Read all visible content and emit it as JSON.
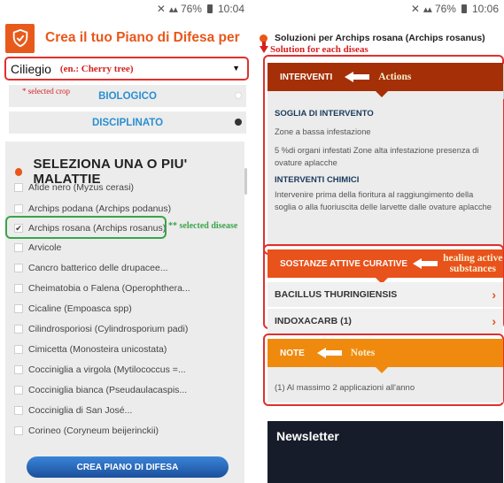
{
  "status_bar": {
    "battery": "76%",
    "time_left": "10:04",
    "time_right": "10:06"
  },
  "left": {
    "title": "Crea il tuo Piano di Difesa per",
    "crop_select": {
      "value": "Ciliegio",
      "annotation": "(en.: Cherry tree)"
    },
    "selected_crop_note": "* selected crop",
    "options": [
      {
        "label": "BIOLOGICO",
        "selected": false
      },
      {
        "label": "DISCIPLINATO",
        "selected": true
      }
    ],
    "section_title": "SELEZIONA UNA O PIU' MALATTIE",
    "diseases": [
      {
        "label": "Afide nero (Myzus cerasi)",
        "checked": false
      },
      {
        "label": "Archips podana (Archips podanus)",
        "checked": false
      },
      {
        "label": "Archips rosana (Archips rosanus)",
        "checked": true
      },
      {
        "label": "Arvicole",
        "checked": false
      },
      {
        "label": "Cancro batterico delle drupacee...",
        "checked": false
      },
      {
        "label": "Cheimatobia o Falena (Operophthera...",
        "checked": false
      },
      {
        "label": "Cicaline (Empoasca spp)",
        "checked": false
      },
      {
        "label": "Cilindrosporiosi (Cylindrosporium padi)",
        "checked": false
      },
      {
        "label": "Cimicetta (Monosteira unicostata)",
        "checked": false
      },
      {
        "label": "Cocciniglia a virgola (Mytilococcus =...",
        "checked": false
      },
      {
        "label": "Cocciniglia bianca (Pseudaulacaspis...",
        "checked": false
      },
      {
        "label": "Cocciniglia di San José...",
        "checked": false
      },
      {
        "label": "Corineo (Coryneum beijerinckii)",
        "checked": false
      }
    ],
    "selected_disease_note": "** selected disease",
    "create_button": "CREA PIANO DI DIFESA"
  },
  "right": {
    "title": "Soluzioni per Archips rosana (Archips rosanus)",
    "solution_note": "Solution for each diseas",
    "interventi": {
      "bar_label": "INTERVENTI",
      "annotation": "Actions",
      "soglia_title": "SOGLIA DI INTERVENTO",
      "soglia_lines": [
        "Zone a bassa infestazione",
        "5 %di organi infestati Zone alta infestazione presenza di ovature aplacche"
      ],
      "chimici_title": "INTERVENTI CHIMICI",
      "chimici_text": "Intervenire prima della fioritura al raggiungimento della soglia o alla fuoriuscita delle larvette dalle ovature aplacche"
    },
    "sostanze": {
      "bar_label": "SOSTANZE ATTIVE CURATIVE",
      "annotation_line1": "healing active",
      "annotation_line2": "substances",
      "items": [
        "BACILLUS THURINGIENSIS",
        "INDOXACARB (1)"
      ]
    },
    "note": {
      "bar_label": "NOTE",
      "annotation": "Notes",
      "text": "(1) Al massimo 2 applicazioni all'anno"
    },
    "newsletter": "Newsletter"
  },
  "colors": {
    "brand_orange": "#e8571a",
    "interventi_bar": "#a52f06",
    "sostanze_bar": "#e8521b",
    "note_bar": "#f08a0f",
    "annotation_red": "#d62020",
    "annotation_green": "#3aa44a",
    "link_blue": "#2b8fd1"
  }
}
